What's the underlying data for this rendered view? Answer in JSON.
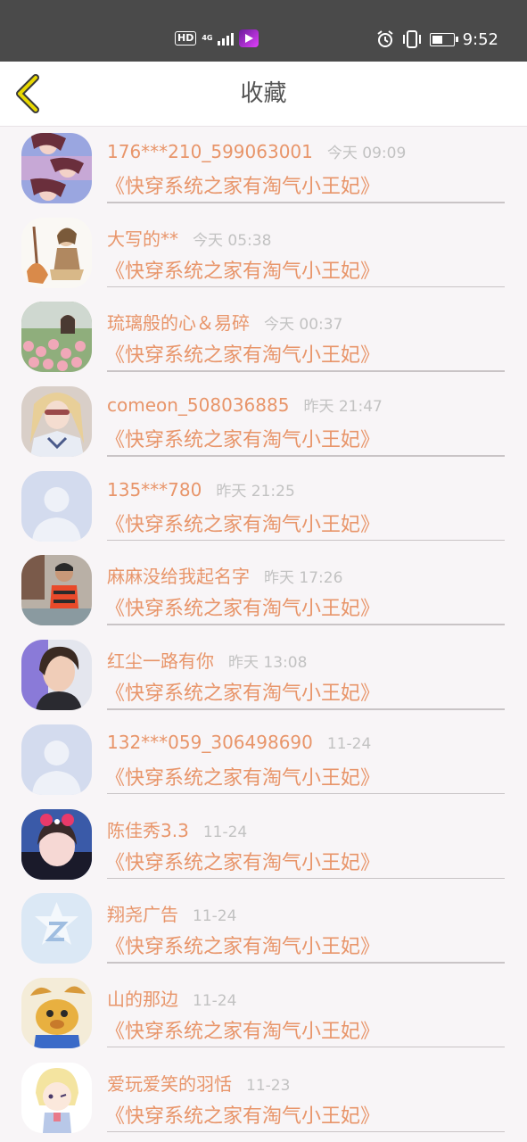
{
  "status_bar": {
    "left_badges": [
      "HD",
      "4G"
    ],
    "time": "9:52"
  },
  "header": {
    "title": "收藏"
  },
  "items": [
    {
      "name": "176***210_599063001",
      "time": "今天 09:09",
      "book": "《快穿系统之家有淘气小王妃》",
      "avatar": "anime-couple"
    },
    {
      "name": "大写的**",
      "time": "今天 05:38",
      "book": "《快穿系统之家有淘气小王妃》",
      "avatar": "sketch-figure"
    },
    {
      "name": "琉璃般的心＆易碎",
      "time": "今天 00:37",
      "book": "《快穿系统之家有淘气小王妃》",
      "avatar": "tulip-field"
    },
    {
      "name": "comeon_508036885",
      "time": "昨天 21:47",
      "book": "《快穿系统之家有淘气小王妃》",
      "avatar": "girl-portrait"
    },
    {
      "name": "135***780",
      "time": "昨天 21:25",
      "book": "《快穿系统之家有淘气小王妃》",
      "avatar": "default-user"
    },
    {
      "name": "麻麻没给我起名字",
      "time": "昨天 17:26",
      "book": "《快穿系统之家有淘气小王妃》",
      "avatar": "kid-photo"
    },
    {
      "name": "红尘一路有你",
      "time": "昨天 13:08",
      "book": "《快穿系统之家有淘气小王妃》",
      "avatar": "man-portrait"
    },
    {
      "name": "132***059_306498690",
      "time": "11-24",
      "book": "《快穿系统之家有淘气小王妃》",
      "avatar": "default-user"
    },
    {
      "name": "陈佳秀3.3",
      "time": "11-24",
      "book": "《快穿系统之家有淘气小王妃》",
      "avatar": "girl-bow"
    },
    {
      "name": "翔尧广告",
      "time": "11-24",
      "book": "《快穿系统之家有淘气小王妃》",
      "avatar": "qq-default"
    },
    {
      "name": "山的那边",
      "time": "11-24",
      "book": "《快穿系统之家有淘气小王妃》",
      "avatar": "cartoon-dog"
    },
    {
      "name": "爱玩爱笑的羽恬",
      "time": "11-23",
      "book": "《快穿系统之家有淘气小王妃》",
      "avatar": "anime-girl"
    }
  ],
  "colors": {
    "accent": "#e8956a",
    "back_arrow": "#e8d800",
    "muted": "#c2c2c2",
    "status_bar": "#4a4a4a"
  }
}
